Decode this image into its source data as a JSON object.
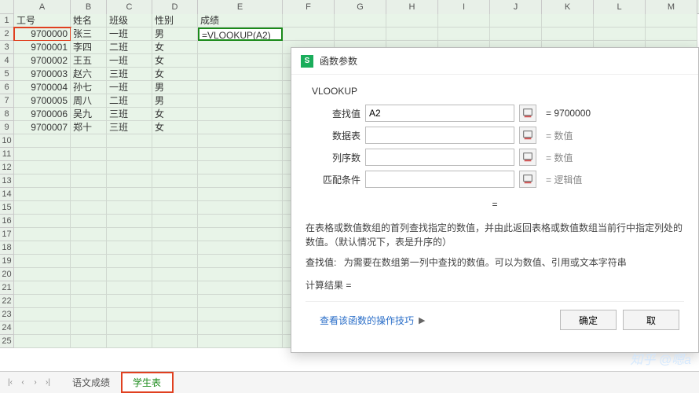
{
  "columns": [
    "A",
    "B",
    "C",
    "D",
    "E",
    "F",
    "G",
    "H",
    "I",
    "J",
    "K",
    "L",
    "M"
  ],
  "row_count": 25,
  "headers": {
    "A": "工号",
    "B": "姓名",
    "C": "班级",
    "D": "性别",
    "E": "成绩"
  },
  "data_rows": [
    {
      "A": "9700000",
      "B": "张三",
      "C": "一班",
      "D": "男",
      "E": "=VLOOKUP(A2)"
    },
    {
      "A": "9700001",
      "B": "李四",
      "C": "二班",
      "D": "女",
      "E": ""
    },
    {
      "A": "9700002",
      "B": "王五",
      "C": "一班",
      "D": "女",
      "E": ""
    },
    {
      "A": "9700003",
      "B": "赵六",
      "C": "三班",
      "D": "女",
      "E": ""
    },
    {
      "A": "9700004",
      "B": "孙七",
      "C": "一班",
      "D": "男",
      "E": ""
    },
    {
      "A": "9700005",
      "B": "周八",
      "C": "二班",
      "D": "男",
      "E": ""
    },
    {
      "A": "9700006",
      "B": "吴九",
      "C": "三班",
      "D": "女",
      "E": ""
    },
    {
      "A": "9700007",
      "B": "郑十",
      "C": "三班",
      "D": "女",
      "E": ""
    }
  ],
  "selected_cell": "E2",
  "highlighted_cell": "A2",
  "tabs": {
    "nav": [
      "|‹",
      "‹",
      "›",
      "›|"
    ],
    "items": [
      "语文成绩",
      "学生表"
    ],
    "active": 1
  },
  "dialog": {
    "title": "函数参数",
    "fn": "VLOOKUP",
    "params": [
      {
        "label": "查找值",
        "value": "A2",
        "result": "9700000",
        "is_value": true
      },
      {
        "label": "数据表",
        "value": "",
        "result": "数值",
        "is_value": false
      },
      {
        "label": "列序数",
        "value": "",
        "result": "数值",
        "is_value": false
      },
      {
        "label": "匹配条件",
        "value": "",
        "result": "逻辑值",
        "is_value": false
      }
    ],
    "eq_label": "=",
    "description": "在表格或数值数组的首列查找指定的数值，并由此返回表格或数值数组当前行中指定列处的数值。（默认情况下，表是升序的）",
    "param_help_label": "查找值:",
    "param_help_text": "为需要在数组第一列中查找的数值。可以为数值、引用或文本字符串",
    "calc_label": "计算结果 =",
    "help_link": "查看该函数的操作技巧",
    "ok": "确定",
    "cancel": "取"
  },
  "watermark": "知乎 @嗯a"
}
